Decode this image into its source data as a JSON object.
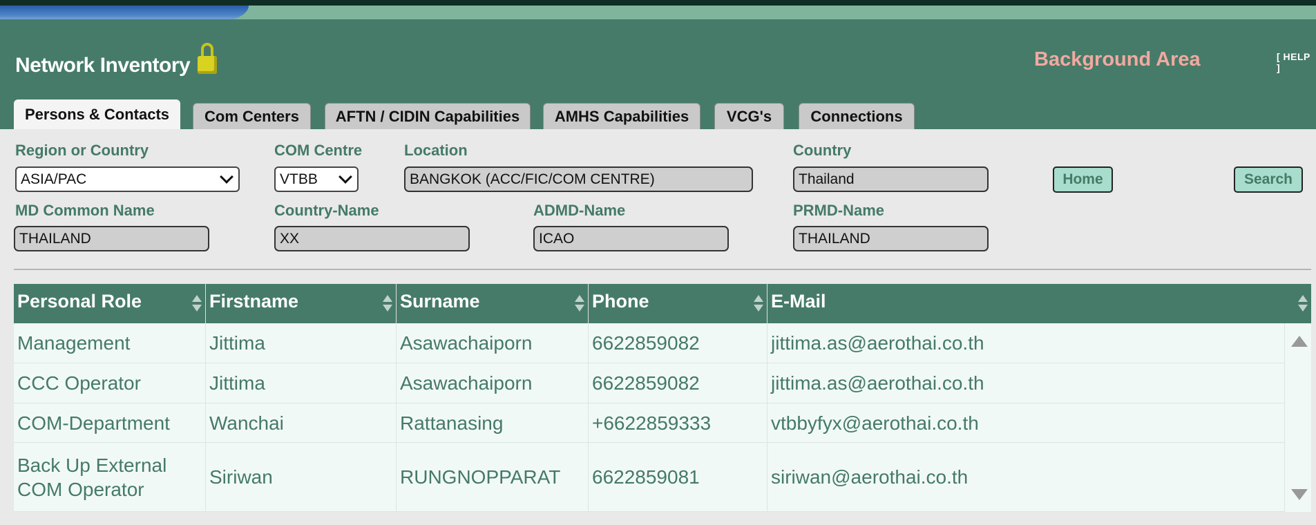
{
  "header": {
    "title": "Network Inventory",
    "area_label": "Background Area",
    "help": "[ HELP ]"
  },
  "tabs": [
    {
      "label": "Persons & Contacts",
      "active": true
    },
    {
      "label": "Com Centers",
      "active": false
    },
    {
      "label": "AFTN / CIDIN Capabilities",
      "active": false
    },
    {
      "label": "AMHS Capabilities",
      "active": false
    },
    {
      "label": "VCG's",
      "active": false
    },
    {
      "label": "Connections",
      "active": false
    }
  ],
  "form": {
    "region_label": "Region or Country",
    "region_value": "ASIA/PAC",
    "com_centre_label": "COM Centre",
    "com_centre_value": "VTBB",
    "location_label": "Location",
    "location_value": "BANGKOK (ACC/FIC/COM CENTRE)",
    "country_label": "Country",
    "country_value": "Thailand",
    "md_common_name_label": "MD Common Name",
    "md_common_name_value": "THAILAND",
    "country_name_label": "Country-Name",
    "country_name_value": "XX",
    "admd_name_label": "ADMD-Name",
    "admd_name_value": "ICAO",
    "prmd_name_label": "PRMD-Name",
    "prmd_name_value": "THAILAND",
    "home_button": "Home",
    "search_button": "Search"
  },
  "table": {
    "columns": [
      "Personal Role",
      "Firstname",
      "Surname",
      "Phone",
      "E-Mail"
    ],
    "rows": [
      [
        "Management",
        "Jittima",
        "Asawachaiporn",
        "6622859082",
        "jittima.as@aerothai.co.th"
      ],
      [
        "CCC Operator",
        "Jittima",
        "Asawachaiporn",
        "6622859082",
        "jittima.as@aerothai.co.th"
      ],
      [
        "COM-Department",
        "Wanchai",
        "Rattanasing",
        "+6622859333",
        "vtbbyfyx@aerothai.co.th"
      ],
      [
        "Back Up External COM Operator",
        "Siriwan",
        "RUNGNOPPARAT",
        "6622859081",
        "siriwan@aerothai.co.th"
      ]
    ]
  },
  "colors": {
    "header_green": "#467b69",
    "label_green": "#457a67",
    "accent_pink": "#f2a9a0",
    "button_mint": "#a8dccc"
  },
  "icons": [
    "lock-icon",
    "sort-icon",
    "chevron-down-icon",
    "scroll-up-icon",
    "scroll-down-icon"
  ]
}
